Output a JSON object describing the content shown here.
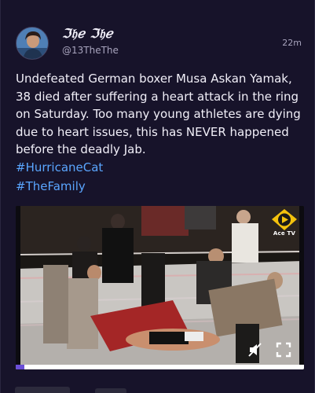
{
  "post": {
    "author": {
      "display_name": "ℑ𝔥ℯ ℑ𝔥ℯ",
      "handle": "@13TheThe",
      "avatar_icon": "profile-photo"
    },
    "time_ago": "22m",
    "body": "Undefeated German boxer Musa Askan Yamak, 38 died after suffering a heart attack in the ring on Saturday. Too many young athletes are dying due to heart issues, this has NEVER happened before the deadly Jab.",
    "hashtags": [
      "#HurricaneCat",
      "#TheFamily"
    ]
  },
  "video": {
    "watermark_text": "Ace TV",
    "progress": 0.03,
    "mute_icon": "speaker-muted-icon",
    "fullscreen_icon": "fullscreen-icon"
  },
  "colors": {
    "background": "#17132a",
    "hashtag": "#5aa6ff",
    "progress_fill": "#6b4fd8",
    "logo_accent": "#f4c20d"
  }
}
